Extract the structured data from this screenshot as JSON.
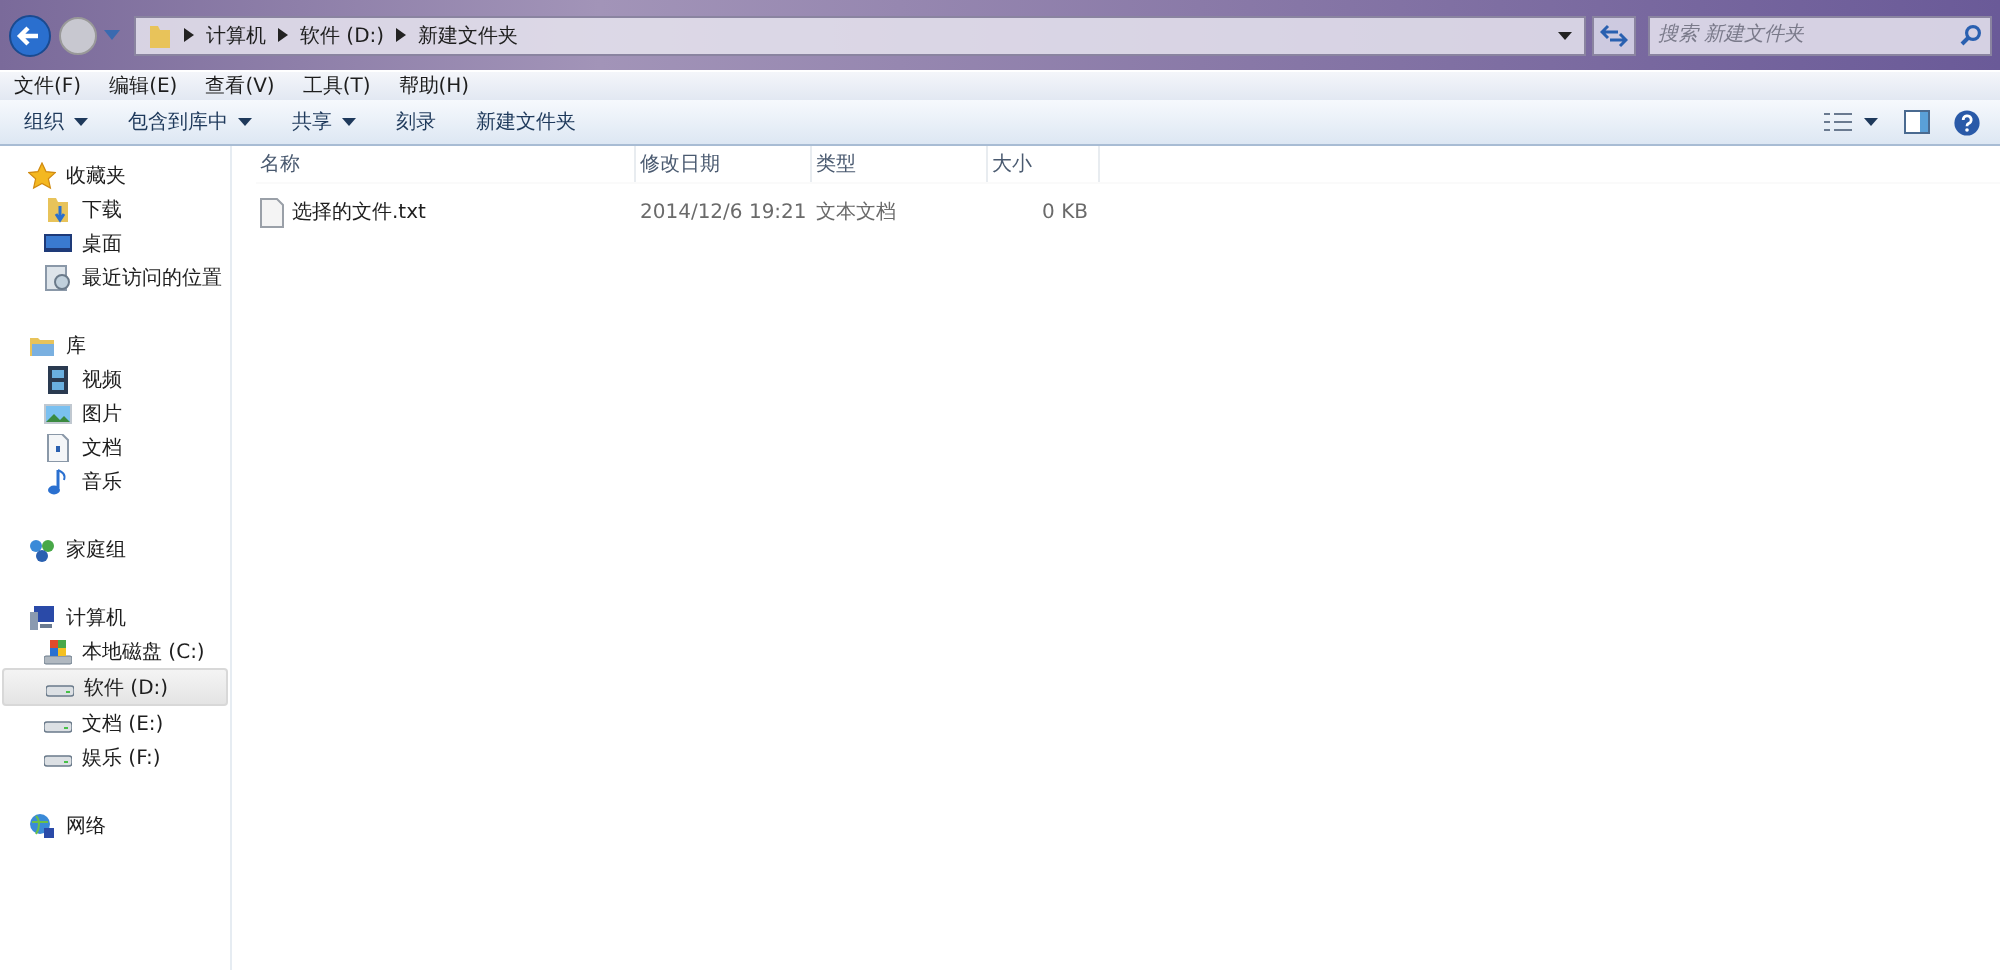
{
  "address_bar": {
    "breadcrumbs": [
      "计算机",
      "软件 (D:)",
      "新建文件夹"
    ]
  },
  "search": {
    "placeholder": "搜索 新建文件夹"
  },
  "menu": [
    "文件(F)",
    "编辑(E)",
    "查看(V)",
    "工具(T)",
    "帮助(H)"
  ],
  "toolbar": [
    {
      "label": "组织",
      "dropdown": true
    },
    {
      "label": "包含到库中",
      "dropdown": true
    },
    {
      "label": "共享",
      "dropdown": true
    },
    {
      "label": "刻录",
      "dropdown": false
    },
    {
      "label": "新建文件夹",
      "dropdown": false
    }
  ],
  "sidebar": {
    "groups": [
      {
        "label": "收藏夹",
        "kind": "star",
        "children": [
          {
            "label": "下载",
            "kind": "download",
            "selected": false
          },
          {
            "label": "桌面",
            "kind": "desktop",
            "selected": false
          },
          {
            "label": "最近访问的位置",
            "kind": "recent",
            "selected": false
          }
        ]
      },
      {
        "label": "库",
        "kind": "library",
        "children": [
          {
            "label": "视频",
            "kind": "video",
            "selected": false
          },
          {
            "label": "图片",
            "kind": "picture",
            "selected": false
          },
          {
            "label": "文档",
            "kind": "document",
            "selected": false
          },
          {
            "label": "音乐",
            "kind": "music",
            "selected": false
          }
        ]
      },
      {
        "label": "家庭组",
        "kind": "homegroup"
      },
      {
        "label": "计算机",
        "kind": "computer",
        "children": [
          {
            "label": "本地磁盘 (C:)",
            "kind": "system-drive",
            "selected": false
          },
          {
            "label": "软件 (D:)",
            "kind": "drive",
            "selected": true
          },
          {
            "label": "文档 (E:)",
            "kind": "drive",
            "selected": false
          },
          {
            "label": "娱乐 (F:)",
            "kind": "drive",
            "selected": false
          }
        ]
      },
      {
        "label": "网络",
        "kind": "network"
      }
    ]
  },
  "table": {
    "columns": [
      "名称",
      "修改日期",
      "类型",
      "大小"
    ],
    "rows": [
      {
        "name": "选择的文件.txt",
        "modified": "2014/12/6 19:21",
        "type": "文本文档",
        "size": "0 KB"
      }
    ]
  }
}
